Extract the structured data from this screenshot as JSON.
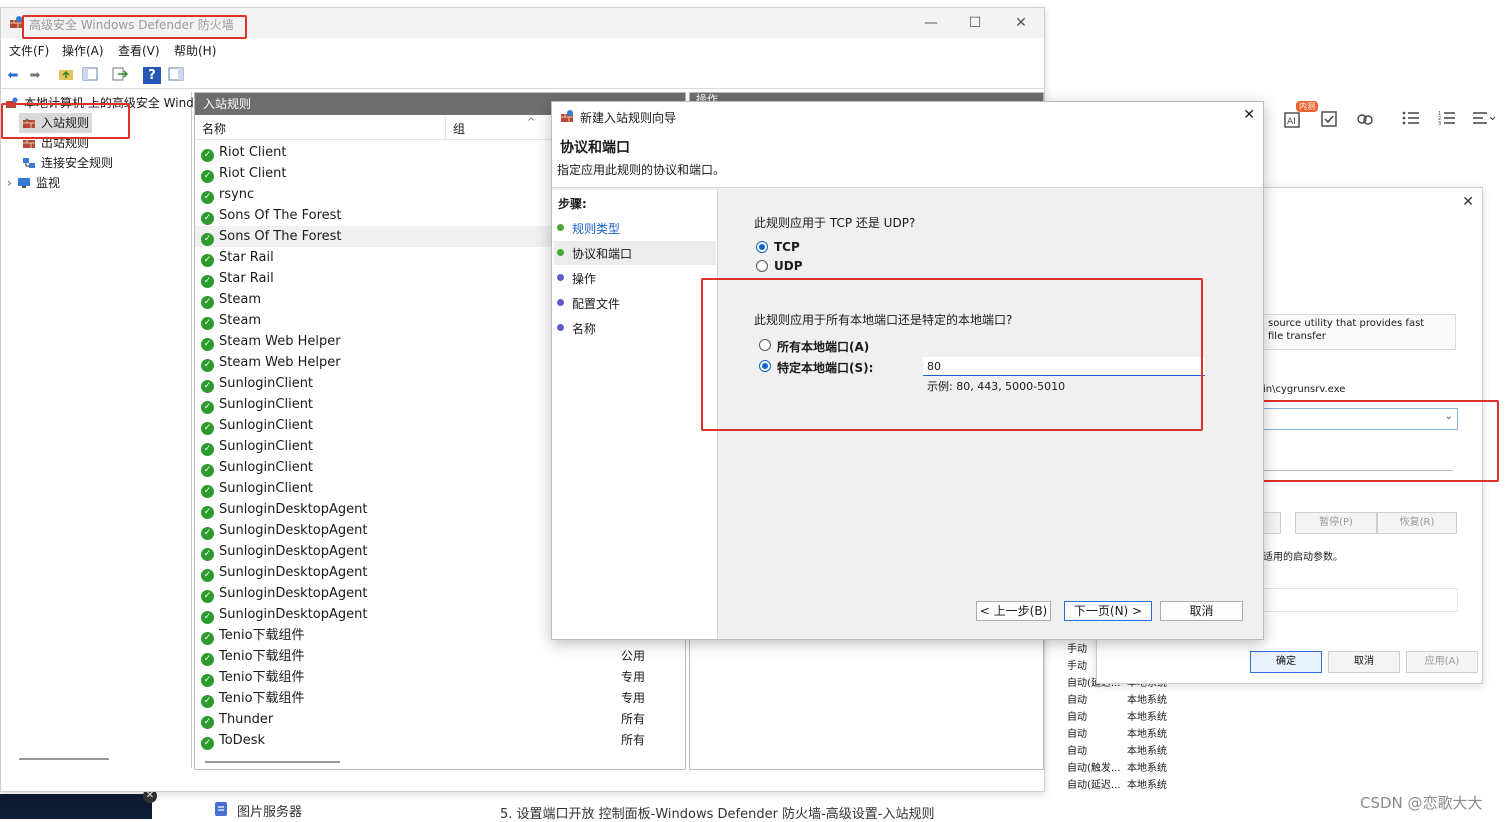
{
  "firewall_window": {
    "title": "高级安全 Windows Defender 防火墙",
    "menu": [
      "文件(F)",
      "操作(A)",
      "查看(V)",
      "帮助(H)"
    ],
    "tree": {
      "root": "本地计算机 上的高级安全 Windows",
      "items": [
        "入站规则",
        "出站规则",
        "连接安全规则",
        "监视"
      ]
    },
    "list": {
      "header": "入站规则",
      "col_name": "名称",
      "col_group": "组",
      "rows": [
        {
          "name": "Riot Client",
          "group": ""
        },
        {
          "name": "Riot Client",
          "group": ""
        },
        {
          "name": "rsync",
          "group": ""
        },
        {
          "name": "Sons Of The Forest",
          "group": ""
        },
        {
          "name": "Sons Of The Forest",
          "group": ""
        },
        {
          "name": "Star Rail",
          "group": ""
        },
        {
          "name": "Star Rail",
          "group": ""
        },
        {
          "name": "Steam",
          "group": ""
        },
        {
          "name": "Steam",
          "group": ""
        },
        {
          "name": "Steam Web Helper",
          "group": ""
        },
        {
          "name": "Steam Web Helper",
          "group": ""
        },
        {
          "name": "SunloginClient",
          "group": ""
        },
        {
          "name": "SunloginClient",
          "group": ""
        },
        {
          "name": "SunloginClient",
          "group": ""
        },
        {
          "name": "SunloginClient",
          "group": ""
        },
        {
          "name": "SunloginClient",
          "group": ""
        },
        {
          "name": "SunloginClient",
          "group": ""
        },
        {
          "name": "SunloginDesktopAgent",
          "group": ""
        },
        {
          "name": "SunloginDesktopAgent",
          "group": ""
        },
        {
          "name": "SunloginDesktopAgent",
          "group": ""
        },
        {
          "name": "SunloginDesktopAgent",
          "group": ""
        },
        {
          "name": "SunloginDesktopAgent",
          "group": ""
        },
        {
          "name": "SunloginDesktopAgent",
          "group": ""
        },
        {
          "name": "Tenio下载组件",
          "group": ""
        },
        {
          "name": "Tenio下载组件",
          "group": "公用"
        },
        {
          "name": "Tenio下载组件",
          "group": "专用"
        },
        {
          "name": "Tenio下载组件",
          "group": "专用"
        },
        {
          "name": "Thunder",
          "group": "所有"
        },
        {
          "name": "ToDesk",
          "group": "所有"
        }
      ]
    },
    "actions_header": "操作"
  },
  "wizard": {
    "title": "新建入站规则向导",
    "heading": "协议和端口",
    "subheading": "指定应用此规则的协议和端口。",
    "steps_label": "步骤:",
    "steps": [
      "规则类型",
      "协议和端口",
      "操作",
      "配置文件",
      "名称"
    ],
    "q_protocol": "此规则应用于 TCP 还是 UDP?",
    "opt_tcp": "TCP",
    "opt_udp": "UDP",
    "q_ports": "此规则应用于所有本地端口还是特定的本地端口?",
    "opt_all_ports": "所有本地端口(A)",
    "opt_specific_ports": "特定本地端口(S):",
    "port_value": "80",
    "port_example": "示例: 80, 443, 5000-5010",
    "btn_back": "< 上一步(B)",
    "btn_next": "下一页(N) >",
    "btn_cancel": "取消"
  },
  "service_dialog": {
    "desc_line1": "source utility that provides fast",
    "desc_line2": "file transfer",
    "path": "in\\cygrunsrv.exe",
    "partial_label": "适用的启动参数。",
    "btn_pause": "暂停(P)",
    "btn_resume": "恢复(R)",
    "btn_ok": "确定",
    "btn_cancel": "取消",
    "btn_apply": "应用(A)"
  },
  "services_list": {
    "rows": [
      {
        "start": "手动",
        "account": ""
      },
      {
        "start": "手动",
        "account": ""
      },
      {
        "start": "自动(延迟...",
        "account": "本地系统"
      },
      {
        "start": "自动",
        "account": "本地系统"
      },
      {
        "start": "自动",
        "account": "本地系统"
      },
      {
        "start": "自动",
        "account": "本地系统"
      },
      {
        "start": "自动",
        "account": "本地系统"
      },
      {
        "start": "自动(触发...",
        "account": "本地系统"
      },
      {
        "start": "自动(延迟...",
        "account": "本地系统"
      }
    ]
  },
  "page": {
    "left_item": "图片服务器",
    "caption": "5. 设置端口开放 控制面板-Windows Defender 防火墙-高级设置-入站规则",
    "watermark": "CSDN @恋歌大大",
    "editor_badge": "内测"
  }
}
